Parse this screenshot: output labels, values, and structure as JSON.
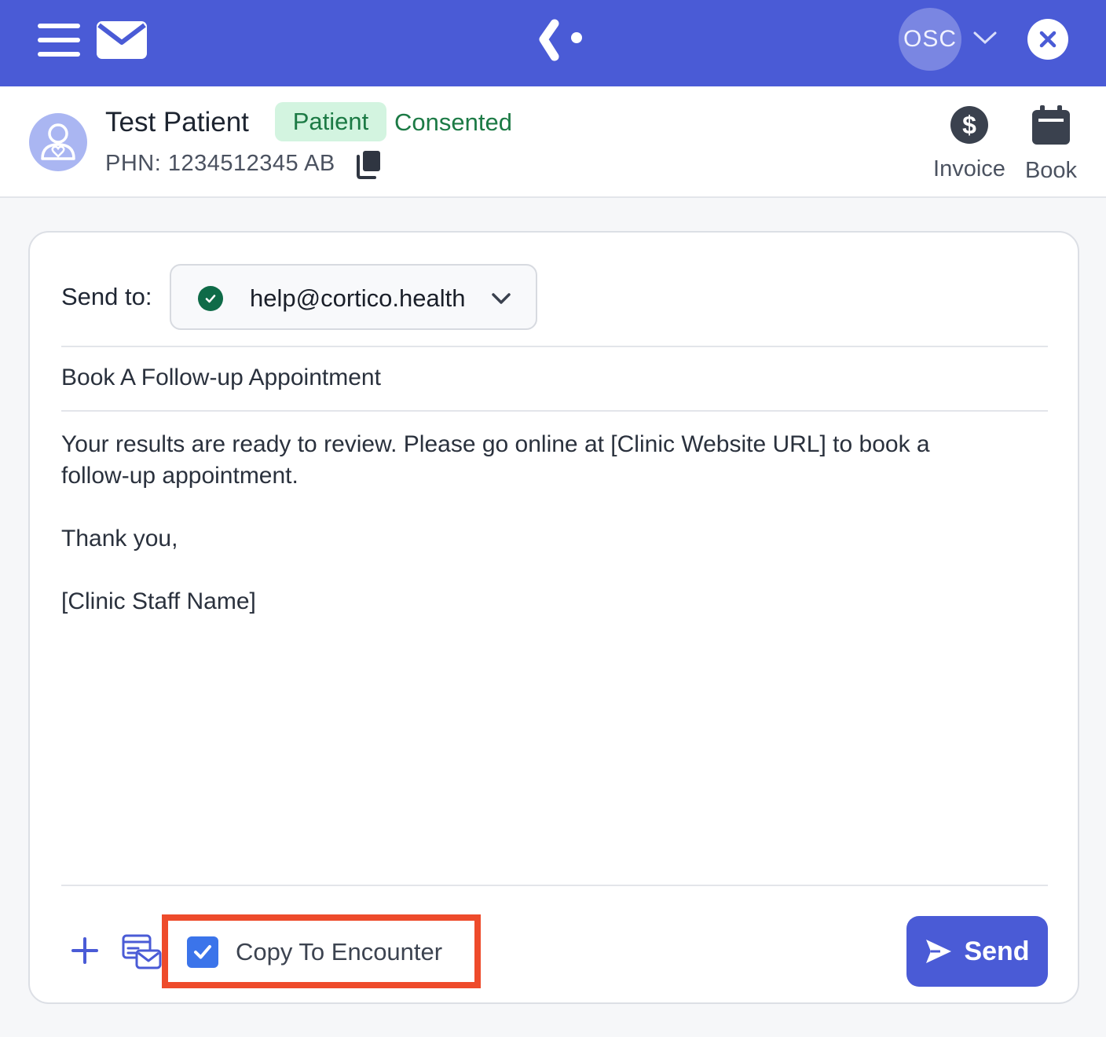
{
  "topbar": {
    "avatar_initials": "OSC",
    "icons": [
      "hamburger-menu-icon",
      "mail-icon",
      "app-logo-icon",
      "chevron-down-icon",
      "close-icon"
    ],
    "background_color": "#4a5bd6"
  },
  "patient": {
    "name": "Test Patient",
    "badge": "Patient",
    "consent_status": "Consented",
    "phn": "PHN: 1234512345 AB",
    "actions": {
      "invoice_label": "Invoice",
      "book_label": "Book"
    }
  },
  "message": {
    "send_to_label": "Send to:",
    "recipient": "help@cortico.health",
    "subject": "Book A Follow-up Appointment",
    "body_lines": [
      "Your results are ready to review. Please go online at [Clinic Website URL] to book a follow-up appointment.",
      "",
      "Thank you,",
      "",
      "[Clinic Staff Name]"
    ],
    "copy_to_encounter_label": "Copy To Encounter",
    "copy_to_encounter_checked": true,
    "send_label": "Send"
  },
  "colors": {
    "accent": "#4a5bd6",
    "consented_green": "#1c7a45",
    "badge_bg": "#d3f4e0",
    "highlight_red": "#ee4b2b",
    "checkbox_blue": "#3b74ea"
  }
}
